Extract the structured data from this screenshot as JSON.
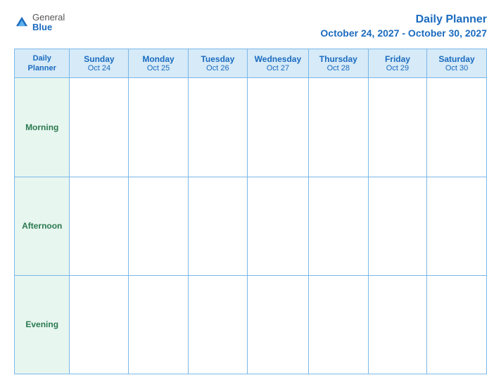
{
  "header": {
    "logo_general": "General",
    "logo_blue": "Blue",
    "title_line1": "Daily Planner",
    "title_line2": "October 24, 2027 - October 30, 2027"
  },
  "table": {
    "first_col_header": {
      "line1": "Daily",
      "line2": "Planner"
    },
    "columns": [
      {
        "day": "Sunday",
        "date": "Oct 24"
      },
      {
        "day": "Monday",
        "date": "Oct 25"
      },
      {
        "day": "Tuesday",
        "date": "Oct 26"
      },
      {
        "day": "Wednesday",
        "date": "Oct 27"
      },
      {
        "day": "Thursday",
        "date": "Oct 28"
      },
      {
        "day": "Friday",
        "date": "Oct 29"
      },
      {
        "day": "Saturday",
        "date": "Oct 30"
      }
    ],
    "rows": [
      {
        "label": "Morning"
      },
      {
        "label": "Afternoon"
      },
      {
        "label": "Evening"
      }
    ]
  }
}
